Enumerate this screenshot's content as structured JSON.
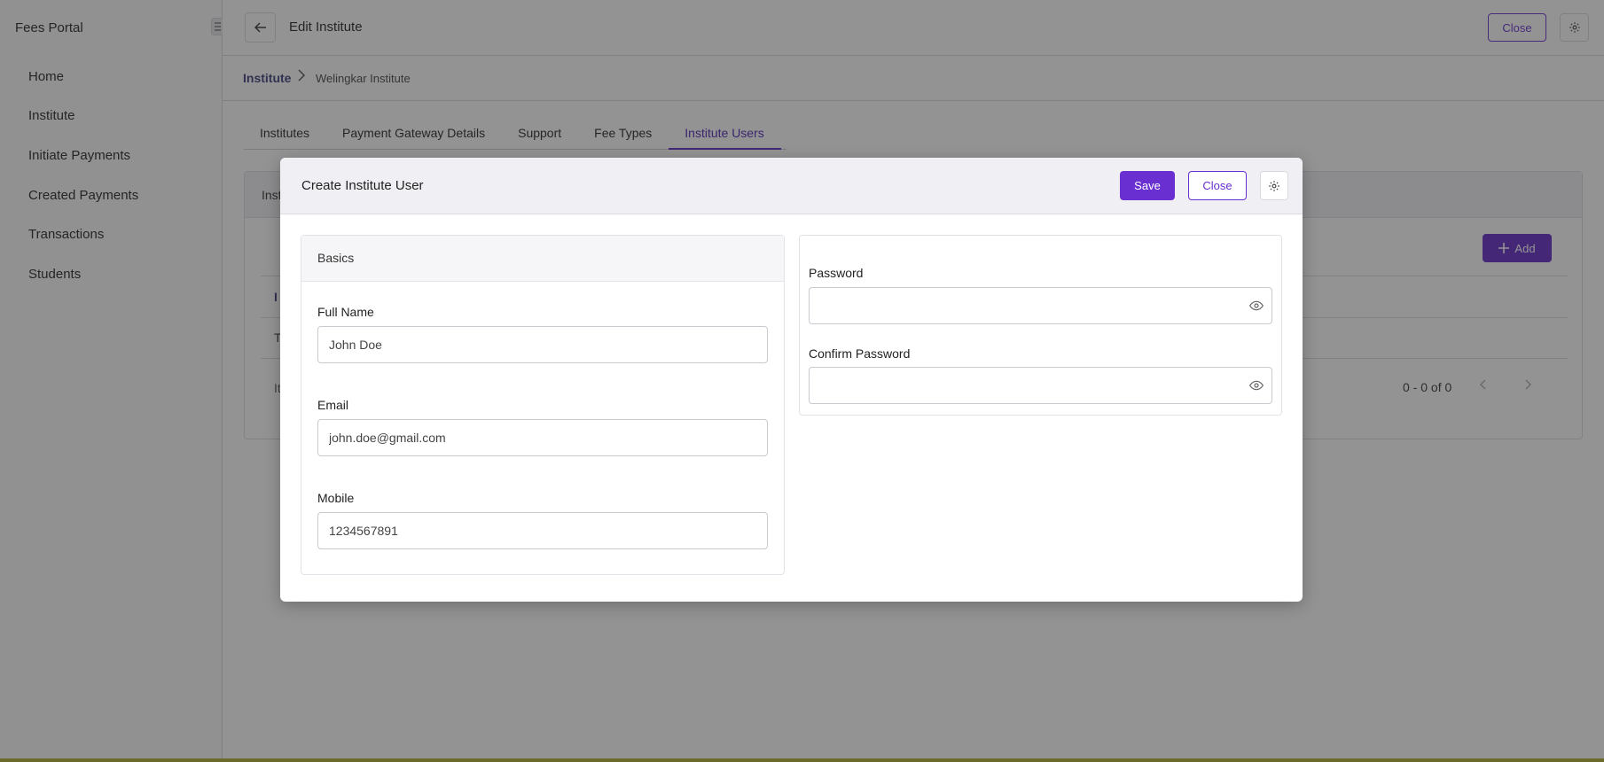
{
  "sidebar": {
    "brand": "Fees Portal",
    "collapse_icon": "collapse-sidebar-icon",
    "items": [
      {
        "label": "Home"
      },
      {
        "label": "Institute"
      },
      {
        "label": "Initiate Payments"
      },
      {
        "label": "Created Payments"
      },
      {
        "label": "Transactions"
      },
      {
        "label": "Students"
      }
    ]
  },
  "topbar": {
    "title": "Edit Institute",
    "close_label": "Close",
    "back_icon": "arrow-left-icon",
    "settings_icon": "gear-icon"
  },
  "breadcrumb": {
    "root": "Institute",
    "current": "Welingkar Institute"
  },
  "tabs": [
    {
      "label": "Institutes",
      "active": false
    },
    {
      "label": "Payment Gateway Details",
      "active": false
    },
    {
      "label": "Support",
      "active": false
    },
    {
      "label": "Fee Types",
      "active": false
    },
    {
      "label": "Institute Users",
      "active": true
    }
  ],
  "background_card": {
    "header_label": "Inst",
    "add_label": "Add",
    "table_header_fragment": "I",
    "row_fragment": "T",
    "pager_left_fragment": "It",
    "pager_range": "0 - 0 of 0"
  },
  "modal": {
    "title": "Create Institute User",
    "save_label": "Save",
    "close_label": "Close",
    "basics": {
      "title": "Basics",
      "full_name_label": "Full Name",
      "full_name_value": "John Doe",
      "email_label": "Email",
      "email_value": "john.doe@gmail.com",
      "mobile_label": "Mobile",
      "mobile_value": "1234567891"
    },
    "security": {
      "password_label": "Password",
      "password_value": "",
      "confirm_label": "Confirm Password",
      "confirm_value": ""
    }
  },
  "colors": {
    "accent": "#6a2fd0",
    "tab_active": "#4b22b0",
    "overlay": "rgba(40,40,40,0.5)"
  }
}
